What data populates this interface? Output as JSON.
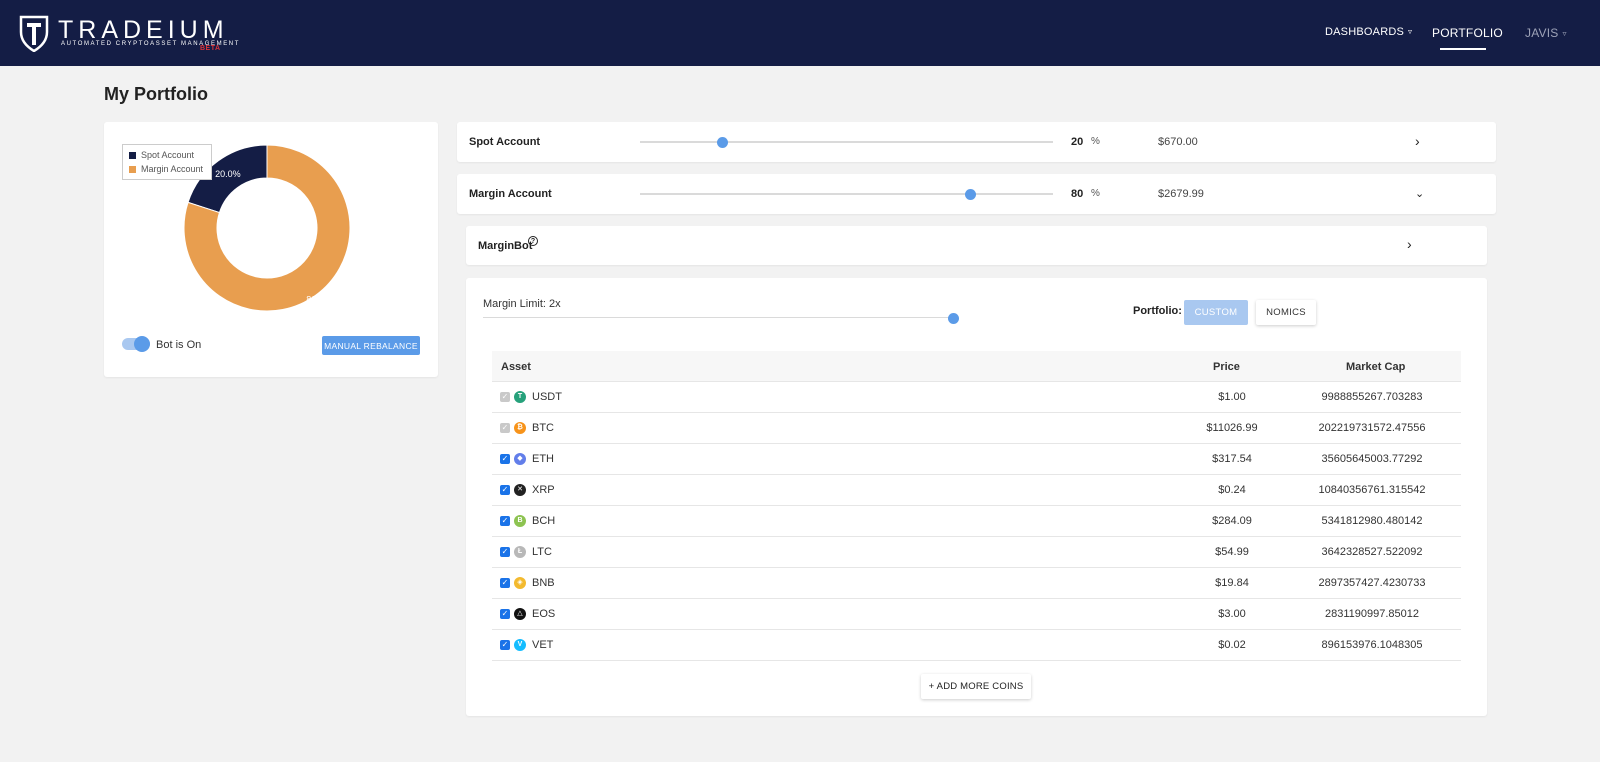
{
  "brand": {
    "name": "TRADEIUM",
    "tagline": "AUTOMATED CRYPTOASSET MANAGEMENT",
    "badge": "BETA"
  },
  "nav": {
    "items": [
      {
        "label": "DASHBOARDS",
        "has_dropdown": true
      },
      {
        "label": "PORTFOLIO",
        "active": true
      },
      {
        "label": "JAVIS",
        "has_dropdown": true
      }
    ]
  },
  "page": {
    "title": "My Portfolio"
  },
  "allocation_chart": {
    "legend": [
      {
        "label": "Spot Account",
        "color": "#141d45"
      },
      {
        "label": "Margin Account",
        "color": "#e89e4f"
      }
    ],
    "slices": [
      {
        "label": "20.0%",
        "value": 20.0,
        "color": "#141d45"
      },
      {
        "label": "80.0%",
        "value": 80.0,
        "color": "#e89e4f"
      }
    ],
    "bot_label": "Bot is On",
    "bot_on": true,
    "rebalance_label": "MANUAL REBALANCE"
  },
  "accounts": [
    {
      "name": "Spot Account",
      "percent": "20",
      "percent_sign": "%",
      "value": "$670.00",
      "slider_fraction": 0.2,
      "expanded": false
    },
    {
      "name": "Margin Account",
      "percent": "80",
      "percent_sign": "%",
      "value": "$2679.99",
      "slider_fraction": 0.8,
      "expanded": true
    }
  ],
  "marginbot": {
    "label": "MarginBot",
    "help": "?"
  },
  "margin_panel": {
    "limit_label": "Margin Limit: 2x",
    "limit_fraction": 1.0,
    "portfolio_label": "Portfolio:",
    "custom_label": "CUSTOM",
    "nomics_label": "NOMICS",
    "add_coins_label": "+ ADD MORE COINS"
  },
  "coins_table": {
    "headers": {
      "asset": "Asset",
      "price": "Price",
      "market_cap": "Market Cap"
    },
    "rows": [
      {
        "symbol": "USDT",
        "price": "$1.00",
        "market_cap": "9988855267.703283",
        "checked": true,
        "locked": true,
        "icon": "T",
        "color": "#26a17b"
      },
      {
        "symbol": "BTC",
        "price": "$11026.99",
        "market_cap": "202219731572.47556",
        "checked": true,
        "locked": true,
        "icon": "₿",
        "color": "#f7931a"
      },
      {
        "symbol": "ETH",
        "price": "$317.54",
        "market_cap": "35605645003.77292",
        "checked": true,
        "locked": false,
        "icon": "◆",
        "color": "#627eea"
      },
      {
        "symbol": "XRP",
        "price": "$0.24",
        "market_cap": "10840356761.315542",
        "checked": true,
        "locked": false,
        "icon": "✕",
        "color": "#222222"
      },
      {
        "symbol": "BCH",
        "price": "$284.09",
        "market_cap": "5341812980.480142",
        "checked": true,
        "locked": false,
        "icon": "B",
        "color": "#8dc351"
      },
      {
        "symbol": "LTC",
        "price": "$54.99",
        "market_cap": "3642328527.522092",
        "checked": true,
        "locked": false,
        "icon": "Ł",
        "color": "#b8b8b8"
      },
      {
        "symbol": "BNB",
        "price": "$19.84",
        "market_cap": "2897357427.4230733",
        "checked": true,
        "locked": false,
        "icon": "◈",
        "color": "#f3ba2f"
      },
      {
        "symbol": "EOS",
        "price": "$3.00",
        "market_cap": "2831190997.85012",
        "checked": true,
        "locked": false,
        "icon": "△",
        "color": "#111111"
      },
      {
        "symbol": "VET",
        "price": "$0.02",
        "market_cap": "896153976.1048305",
        "checked": true,
        "locked": false,
        "icon": "V",
        "color": "#15bdff"
      }
    ]
  }
}
